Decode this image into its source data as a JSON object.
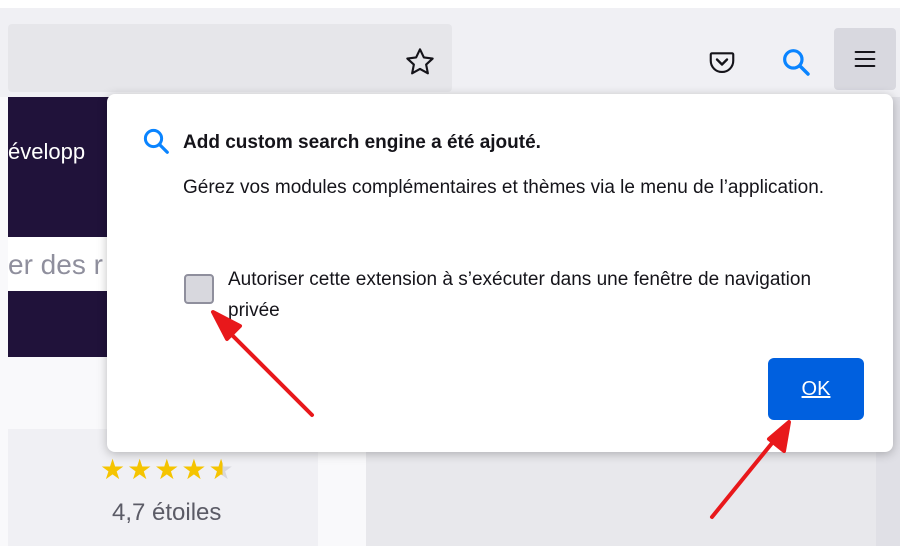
{
  "browser": {
    "star_icon": "star-icon",
    "pocket_icon": "pocket-icon",
    "search_icon": "search-icon",
    "menu_icon": "hamburger-menu-icon"
  },
  "page": {
    "heading_fragment": "évelopp",
    "search_fragment": "er des r",
    "rating": {
      "stars": 4.7,
      "label": "4,7 étoiles"
    }
  },
  "notification": {
    "title": "Add custom search engine a été ajouté.",
    "description": "Gérez vos modules complémentaires et thèmes via le menu de l’application.",
    "checkbox_label": "Autoriser cette extension à s’exécuter dans une fenêtre de navigation privée",
    "checkbox_checked": false,
    "ok_label": "OK"
  },
  "colors": {
    "accent": "#0060df",
    "page_header": "#20123a",
    "star": "#f5c400",
    "annotation_arrow": "#e8181b"
  }
}
